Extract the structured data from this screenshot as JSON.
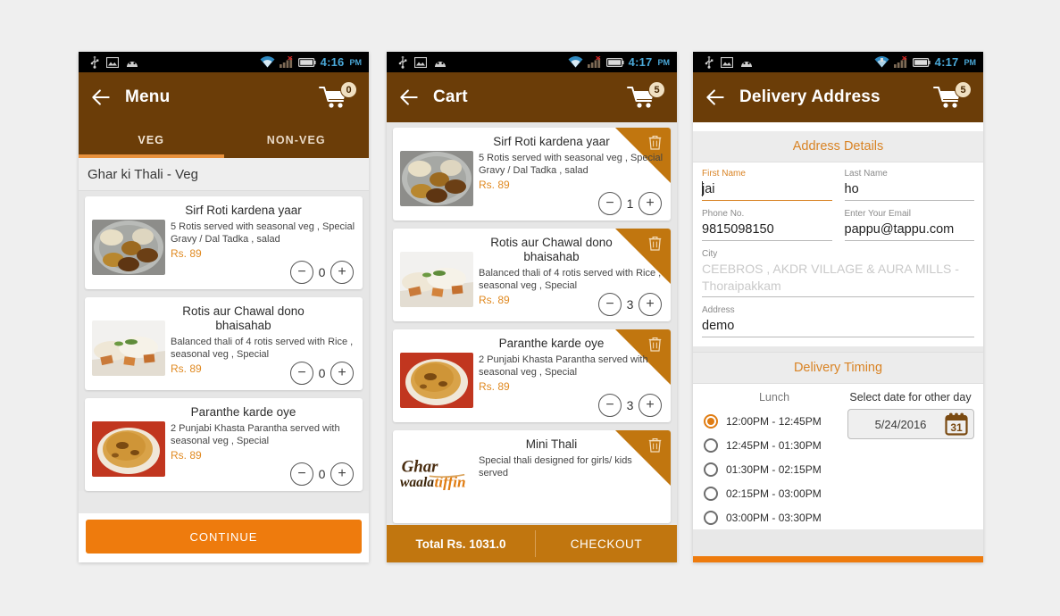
{
  "theme": {
    "brown": "#6b3d08",
    "orange": "#ee7b0d",
    "accent_orange": "#d98324",
    "cart_bar": "#c1760f",
    "page_bg": "#efefef"
  },
  "status_bar": {
    "icons": [
      "usb-icon",
      "image-icon",
      "android-face-icon",
      "wifi-icon",
      "signal-icon",
      "battery-icon"
    ],
    "time_1": "4:16",
    "time_2": "4:17",
    "time_3": "4:17",
    "ampm": "PM"
  },
  "phone1": {
    "title": "Menu",
    "cart_count": "0",
    "tabs": [
      {
        "label": "VEG",
        "active": true
      },
      {
        "label": "NON-VEG",
        "active": false
      }
    ],
    "section_title": "Ghar ki Thali - Veg",
    "items": [
      {
        "name": "Sirf Roti kardena yaar",
        "desc": "5 Rotis served with seasonal veg , Special Gravy / Dal Tadka , salad",
        "price": "Rs. 89",
        "qty": "0",
        "image": "thali-steel-plate"
      },
      {
        "name": "Rotis  aur Chawal dono  bhaisahab",
        "desc": "Balanced thali of 4 rotis served with Rice , seasonal veg , Special",
        "price": "Rs. 89",
        "qty": "0",
        "image": "rice-roti-plate"
      },
      {
        "name": "Paranthe karde oye",
        "desc": "2 Punjabi Khasta Parantha served with seasonal veg , Special",
        "price": "Rs. 89",
        "qty": "0",
        "image": "parantha-plate"
      }
    ],
    "continue_label": "CONTINUE"
  },
  "phone2": {
    "title": "Cart",
    "cart_count": "5",
    "delete_icon": "trash-icon",
    "items": [
      {
        "name": "Sirf Roti kardena yaar",
        "desc": "5 Rotis served with seasonal veg , Special Gravy / Dal Tadka , salad",
        "price": "Rs. 89",
        "qty": "1",
        "image": "thali-steel-plate"
      },
      {
        "name": "Rotis  aur Chawal dono  bhaisahab",
        "desc": "Balanced thali of 4 rotis served with Rice , seasonal veg , Special",
        "price": "Rs. 89",
        "qty": "3",
        "image": "rice-roti-plate"
      },
      {
        "name": "Paranthe karde oye",
        "desc": "2 Punjabi Khasta Parantha served with seasonal veg , Special",
        "price": "Rs. 89",
        "qty": "3",
        "image": "parantha-plate"
      },
      {
        "name": "Mini Thali",
        "desc": "Special thali designed for girls/ kids served",
        "price": "",
        "qty": "",
        "image": "ghar-waala-tiffin-logo"
      }
    ],
    "logo": {
      "word1": "Ghar",
      "word2": "waala",
      "word3": "tiffin"
    },
    "total_label": "Total Rs. 1031.0",
    "checkout_label": "CHECKOUT"
  },
  "phone3": {
    "title": "Delivery Address",
    "cart_count": "5",
    "address_band": "Address Details",
    "fields": [
      {
        "label": "First Name",
        "value": "jai",
        "focused": true,
        "placeholder": false
      },
      {
        "label": "Last Name",
        "value": "ho",
        "focused": false,
        "placeholder": false
      },
      {
        "label": "Phone No.",
        "value": "9815098150",
        "focused": false,
        "placeholder": false
      },
      {
        "label": "Enter Your Email",
        "value": "pappu@tappu.com",
        "focused": false,
        "placeholder": false
      },
      {
        "label": "City",
        "value": "CEEBROS , AKDR VILLAGE & AURA MILLS - Thoraipakkam",
        "focused": false,
        "placeholder": true
      },
      {
        "label": "Address",
        "value": "demo",
        "focused": false,
        "placeholder": false
      }
    ],
    "timing_band": "Delivery Timing",
    "lunch_label": "Lunch",
    "date_label": "Select date for other day",
    "slots": [
      {
        "label": "12:00PM - 12:45PM",
        "selected": true
      },
      {
        "label": "12:45PM - 01:30PM",
        "selected": false
      },
      {
        "label": "01:30PM - 02:15PM",
        "selected": false
      },
      {
        "label": "02:15PM - 03:00PM",
        "selected": false
      },
      {
        "label": "03:00PM - 03:30PM",
        "selected": false
      }
    ],
    "date_value": "5/24/2016",
    "calendar_icon": "calendar-icon",
    "calendar_day": "31"
  }
}
